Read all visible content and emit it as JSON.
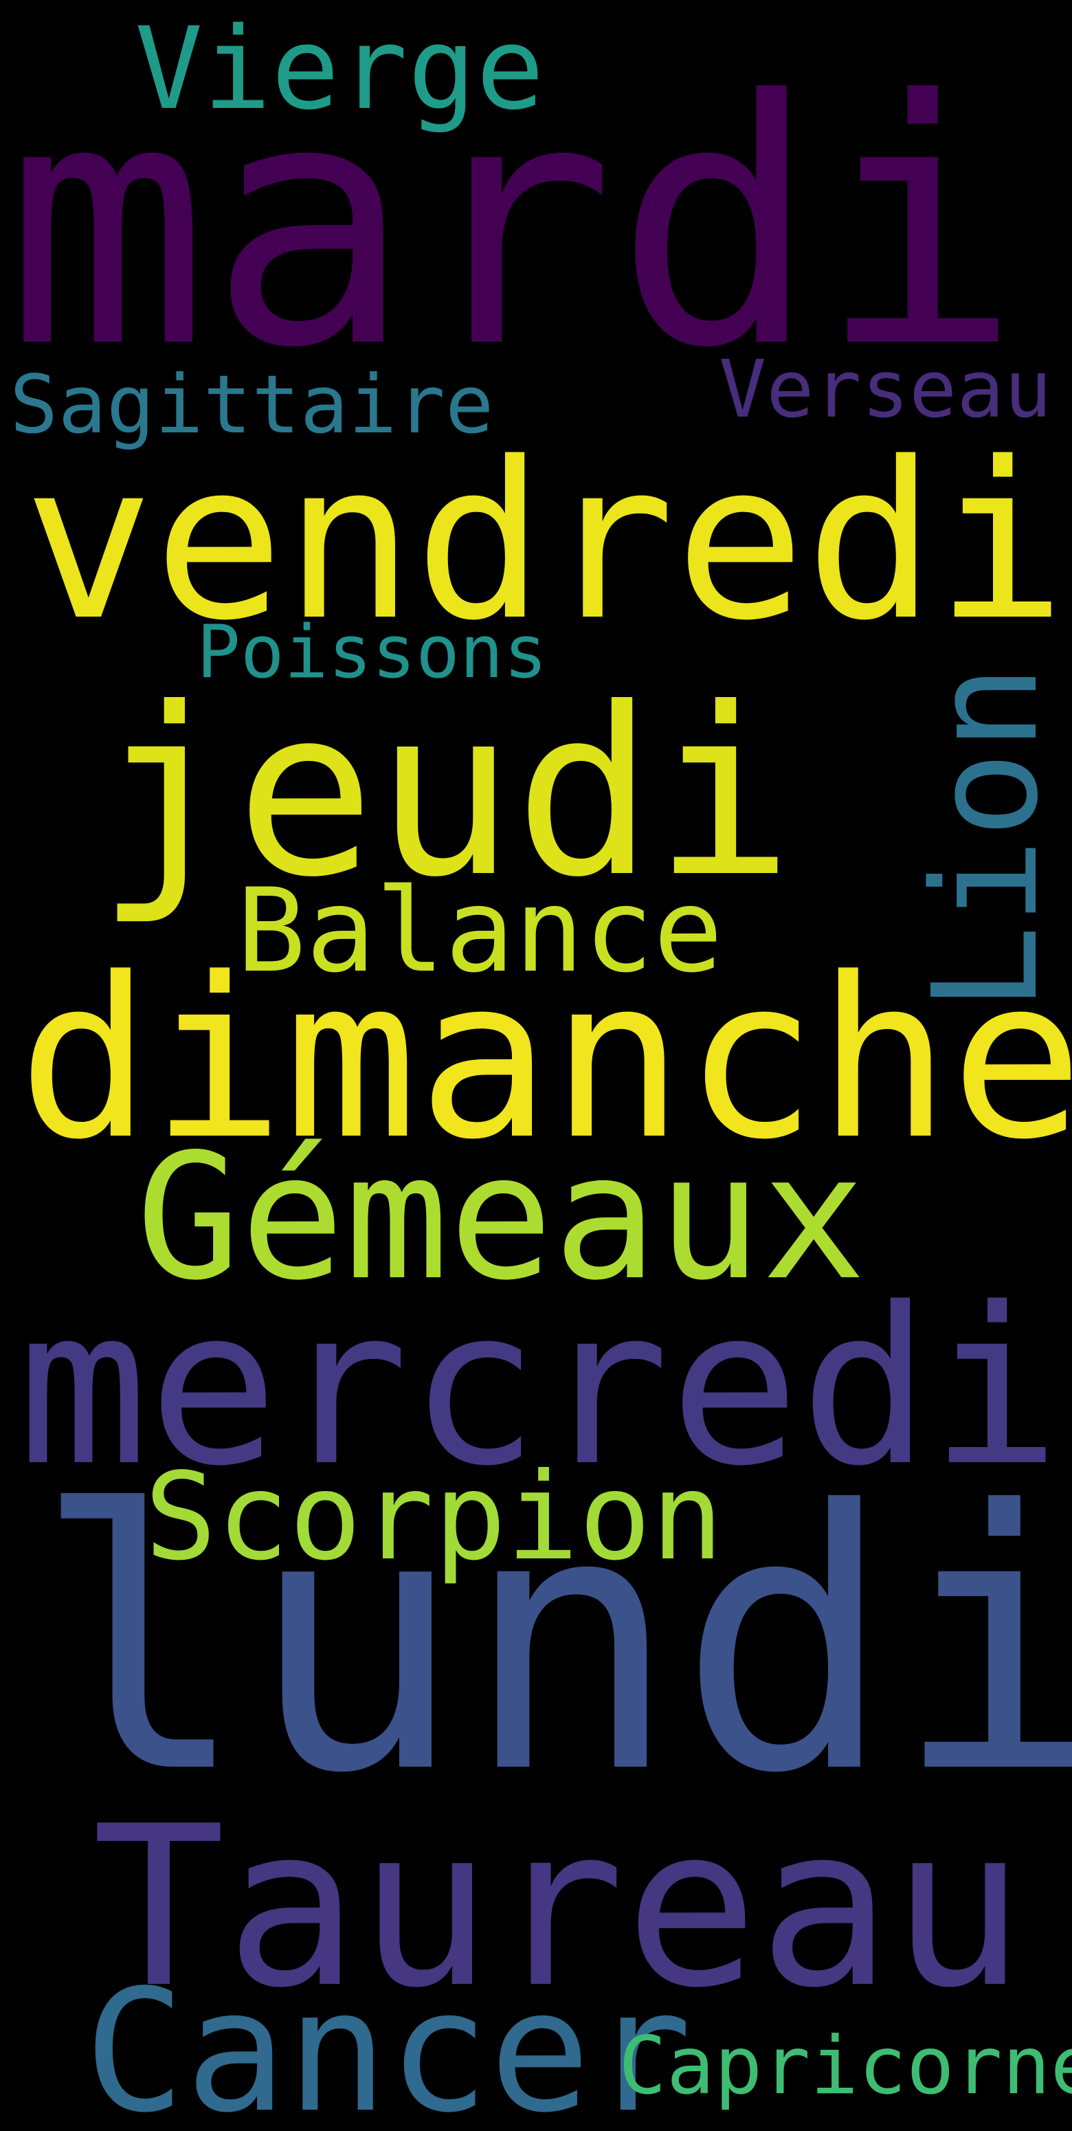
{
  "background": "#000000",
  "words": [
    {
      "id": "mardi",
      "text": "mardi",
      "color": "#440154"
    },
    {
      "id": "vierge",
      "text": "Vierge",
      "color": "#1e9c89"
    },
    {
      "id": "sagittaire",
      "text": "Sagittaire",
      "color": "#2a788e"
    },
    {
      "id": "verseau",
      "text": "Verseau",
      "color": "#472d7b"
    },
    {
      "id": "vendredi",
      "text": "vendredi",
      "color": "#ece51b"
    },
    {
      "id": "poissons",
      "text": "Poissons",
      "color": "#21918c"
    },
    {
      "id": "lion",
      "text": "Lion",
      "color": "#2c728e"
    },
    {
      "id": "jeudi",
      "text": "jeudi",
      "color": "#dde318"
    },
    {
      "id": "balance",
      "text": "Balance",
      "color": "#c8e020"
    },
    {
      "id": "dimanche",
      "text": "dimanche",
      "color": "#f1e51d"
    },
    {
      "id": "gemeaux",
      "text": "Gémeaux",
      "color": "#addc30"
    },
    {
      "id": "mercredi",
      "text": "mercredi",
      "color": "#443a83"
    },
    {
      "id": "scorpion",
      "text": "Scorpion",
      "color": "#a2da37"
    },
    {
      "id": "lundi",
      "text": "lundi",
      "color": "#3b528b"
    },
    {
      "id": "taureau",
      "text": "Taureau",
      "color": "#453781"
    },
    {
      "id": "cancer",
      "text": "Cancer",
      "color": "#306a8e"
    },
    {
      "id": "capricorne",
      "text": "Capricorne",
      "color": "#3fbc73"
    }
  ]
}
